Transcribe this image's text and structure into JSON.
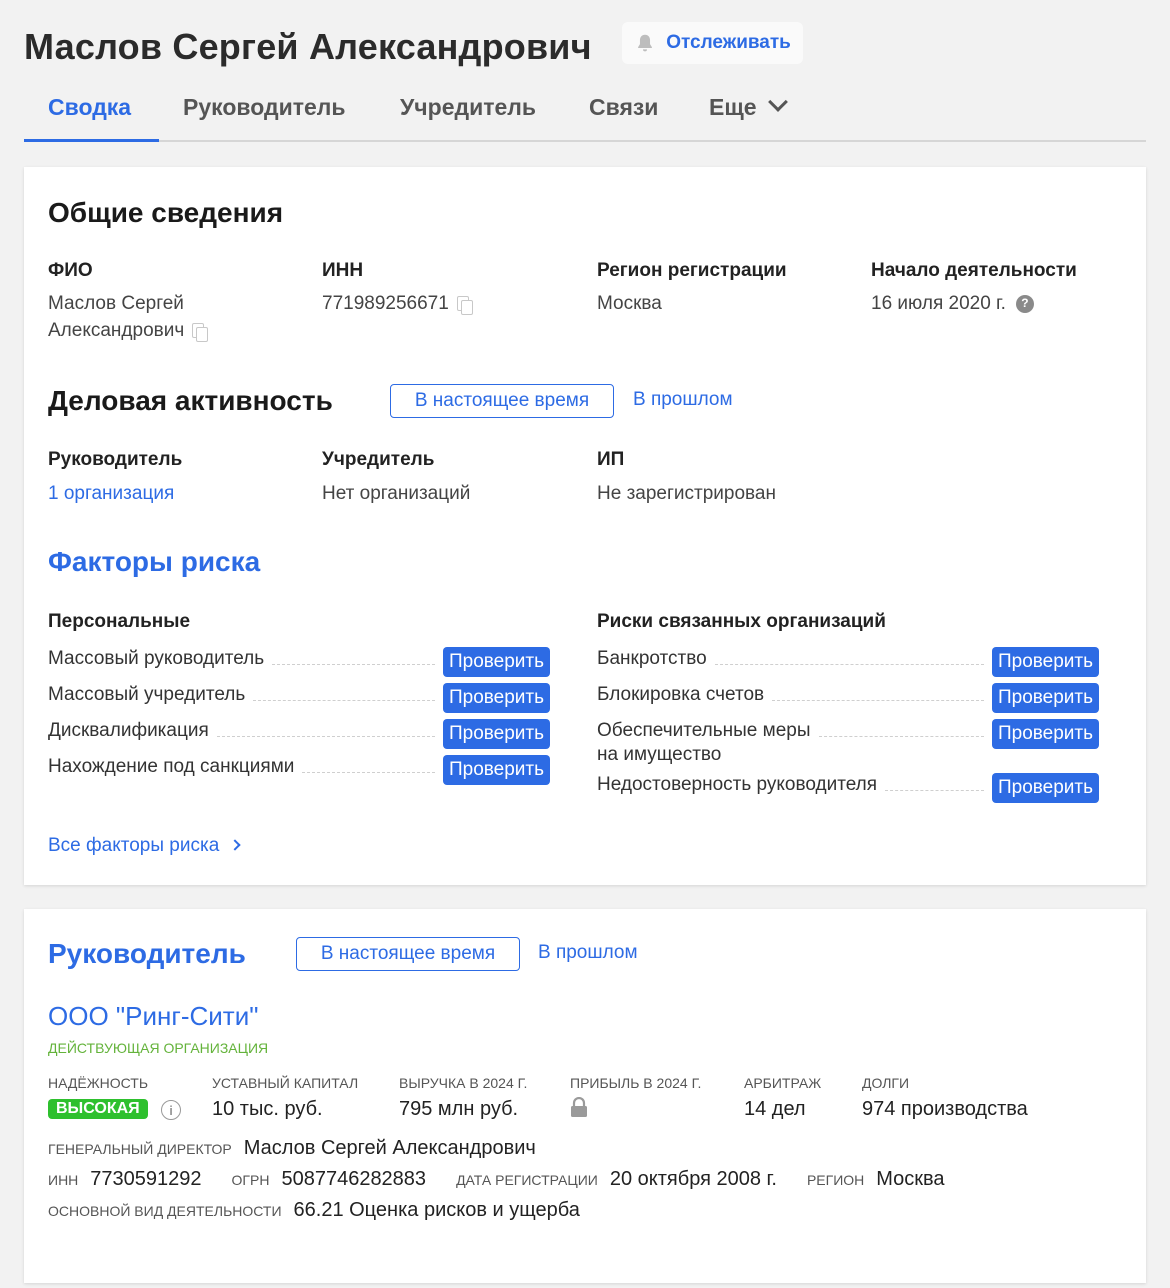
{
  "header": {
    "title": "Маслов Сергей Александрович",
    "track_label": "Отслеживать"
  },
  "tabs": [
    {
      "label": "Сводка"
    },
    {
      "label": "Руководитель"
    },
    {
      "label": "Учредитель"
    },
    {
      "label": "Связи"
    },
    {
      "label": "Еще"
    }
  ],
  "general": {
    "heading": "Общие сведения",
    "fio_label": "ФИО",
    "fio_line1": "Маслов Сергей",
    "fio_line2": "Александрович",
    "inn_label": "ИНН",
    "inn_value": "771989256671",
    "region_label": "Регион регистрации",
    "region_value": "Москва",
    "start_label": "Начало деятельности",
    "start_value": "16 июля 2020 г.",
    "help_glyph": "?"
  },
  "activity": {
    "heading": "Деловая активность",
    "toggle_now": "В настоящее время",
    "toggle_past": "В прошлом",
    "director_label": "Руководитель",
    "director_value": "1 организация",
    "founder_label": "Учредитель",
    "founder_value": "Нет организаций",
    "ip_label": "ИП",
    "ip_value": "Не зарегистрирован"
  },
  "risks": {
    "heading": "Факторы риска",
    "check_label": "Проверить",
    "personal_heading": "Персональные",
    "personal": [
      {
        "name": "Массовый руководитель"
      },
      {
        "name": "Массовый учредитель"
      },
      {
        "name": "Дисквалификация"
      },
      {
        "name": "Нахождение под санкциями"
      }
    ],
    "related_heading": "Риски связанных организаций",
    "related": [
      {
        "name": "Банкротство"
      },
      {
        "name": "Блокировка счетов"
      },
      {
        "name_line1": "Обеспечительные меры",
        "name_line2": "на имущество"
      },
      {
        "name": "Недостоверность руководителя"
      }
    ],
    "all_link": "Все факторы риска"
  },
  "director_section": {
    "heading": "Руководитель",
    "toggle_now": "В настоящее время",
    "toggle_past": "В прошлом",
    "org_name": "ООО \"Ринг-Сити\"",
    "org_status": "Действующая организация",
    "reliability_label": "Надёжность",
    "reliability_value": "ВЫСОКАЯ",
    "info_glyph": "i",
    "capital_label": "Уставный капитал",
    "capital_value": "10 тыс. руб.",
    "revenue_label": "Выручка в 2024 г.",
    "revenue_value": "795 млн руб.",
    "profit_label": "Прибыль в 2024 г.",
    "arbitration_label": "Арбитраж",
    "arbitration_value": "14 дел",
    "debts_label": "Долги",
    "debts_value": "974 производства",
    "gd_label": "Генеральный директор",
    "gd_value": "Маслов Сергей Александрович",
    "inn_label": "ИНН",
    "inn_value": "7730591292",
    "ogrn_label": "ОГРН",
    "ogrn_value": "5087746282883",
    "regdate_label": "Дата регистрации",
    "regdate_value": "20 октября 2008 г.",
    "region_label": "Регион",
    "region_value": "Москва",
    "activity_label": "Основной вид деятельности",
    "activity_value": "66.21 Оценка рисков и ущерба"
  },
  "colors": {
    "accent": "#2d6be4",
    "success": "#2ec02e",
    "status_green": "#64b33b"
  }
}
